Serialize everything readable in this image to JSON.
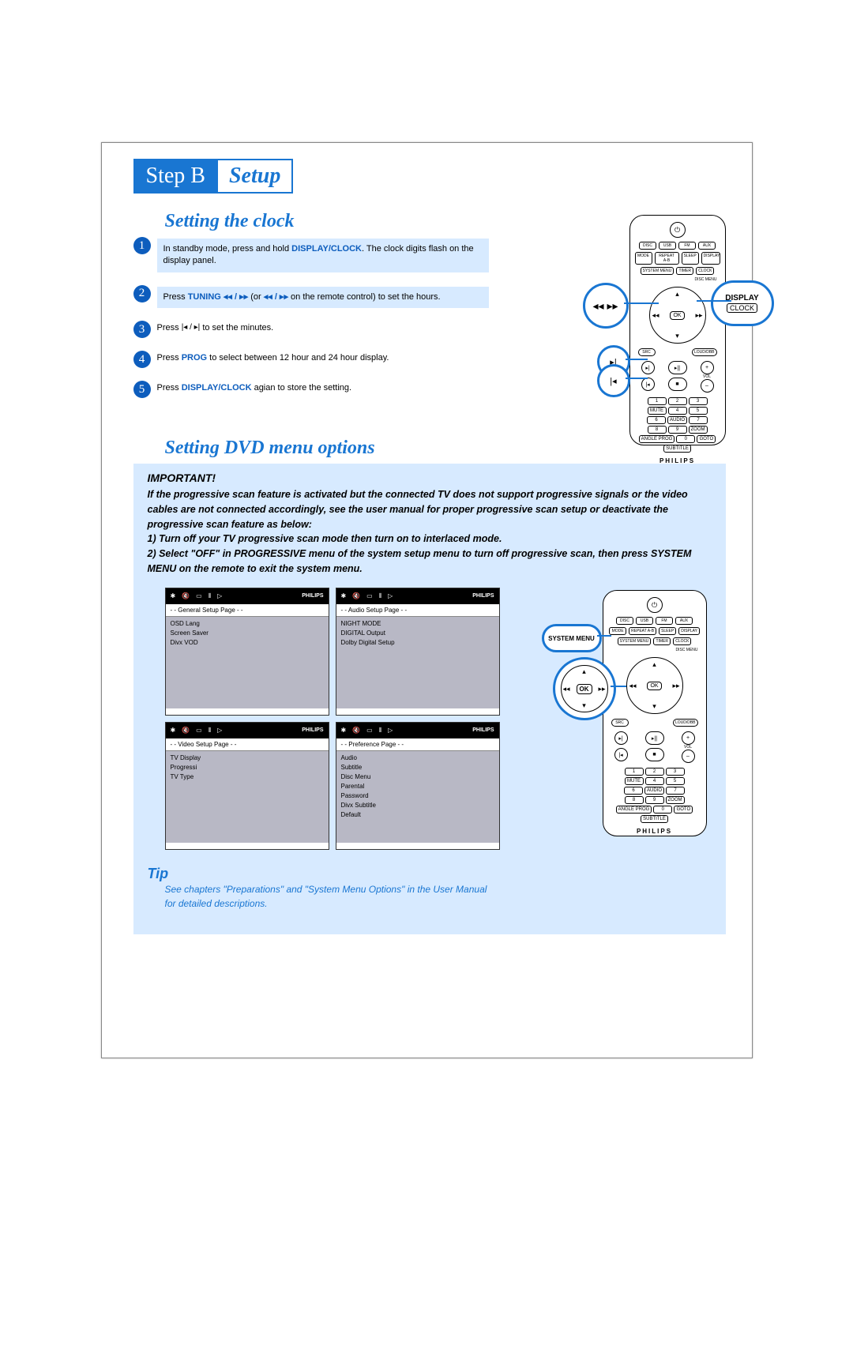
{
  "header": {
    "stepB": "Step B",
    "setup": "Setup"
  },
  "clock": {
    "title": "Setting the clock",
    "steps": [
      {
        "n": "1",
        "pre": "In standby mode, press and hold ",
        "b": "DISPLAY/CLOCK",
        "post": ". The clock digits flash on the display panel.",
        "hl": true
      },
      {
        "n": "2",
        "pre": "Press ",
        "b": "TUNING ◂◂ / ▸▸ ",
        "mid": "(or ",
        "b2": "◂◂ / ▸▸",
        "post": " on the remote control) to set the hours.",
        "hl": true
      },
      {
        "n": "3",
        "pre": "Press  ",
        "ico": "|◂ / ▸|",
        "post": "  to set the minutes.",
        "hl": false
      },
      {
        "n": "4",
        "pre": "Press ",
        "b": "PROG",
        "post": " to select between 12 hour and 24 hour display.",
        "hl": false
      },
      {
        "n": "5",
        "pre": "Press ",
        "b": "DISPLAY/CLOCK",
        "post": " agian to store the setting.",
        "hl": false
      }
    ],
    "callout_rew": "◂◂  ▸▸",
    "callout_display": "DISPLAY",
    "callout_clock": "CLOCK",
    "callout_skip_next": "▸|",
    "callout_skip_prev": "|◂"
  },
  "dvd": {
    "title": "Setting DVD menu options",
    "imp_head": "IMPORTANT!",
    "imp_text": "If the progressive scan feature is activated but the connected TV does not support progressive signals or the video cables are not connected accordingly, see the user manual for proper progressive scan setup or deactivate the progressive scan feature as below:\n1) Turn off your TV progressive scan mode then turn on to interlaced mode.\n2) Select \"OFF\" in PROGRESSIVE menu of the system setup menu to turn off progressive scan, then press SYSTEM MENU on the remote to exit the system menu.",
    "menus": [
      {
        "page": "- -   General Setup Page   - -",
        "items": [
          "OSD Lang",
          "Screen Saver",
          "Divx VOD"
        ]
      },
      {
        "page": "- -   Audio Setup Page   - -",
        "items": [
          "NIGHT MODE",
          "DIGITAL Output",
          "Dolby Digital Setup"
        ]
      },
      {
        "page": "- -   Video Setup Page   - -",
        "items": [
          "TV Display",
          "Progressi",
          "TV Type"
        ]
      },
      {
        "page": "- -   Preference Page   - -",
        "items": [
          "Audio",
          "Subtitle",
          "Disc Menu",
          "Parental",
          "Password",
          "Divx Subtitle",
          "Default"
        ]
      }
    ],
    "brand": "PHILIPS",
    "callout_sys": "SYSTEM MENU",
    "callout_ok": "OK",
    "tip_head": "Tip",
    "tip_text": "See chapters \"Preparations\" and \"System Menu Options\" in the User Manual for detailed descriptions."
  },
  "remote": {
    "power": "⏻",
    "row1": [
      "DISC",
      "USB",
      "FM",
      "AUX"
    ],
    "row2": [
      "MODE",
      "REPEAT A-B",
      "SLEEP",
      "DISPLAY"
    ],
    "row3": [
      "SYSTEM MENU",
      "",
      "TIMER",
      "CLOCK"
    ],
    "row_disc": "DISC MENU",
    "ok": "OK",
    "src_l": "SRC",
    "src_r": "LOUD/DBB",
    "play": "▸||",
    "stop": "■",
    "next": "▸|",
    "prev": "|◂",
    "volp": "+",
    "volm": "–",
    "vol": "VOL",
    "num": [
      "1",
      "2",
      "3",
      "MUTE",
      "4",
      "5",
      "6",
      "AUDIO",
      "7",
      "8",
      "9",
      "ZOOM",
      "ANGLE PROG",
      "0",
      "GOTO",
      "SUBTITLE"
    ],
    "brand": "PHILIPS"
  }
}
